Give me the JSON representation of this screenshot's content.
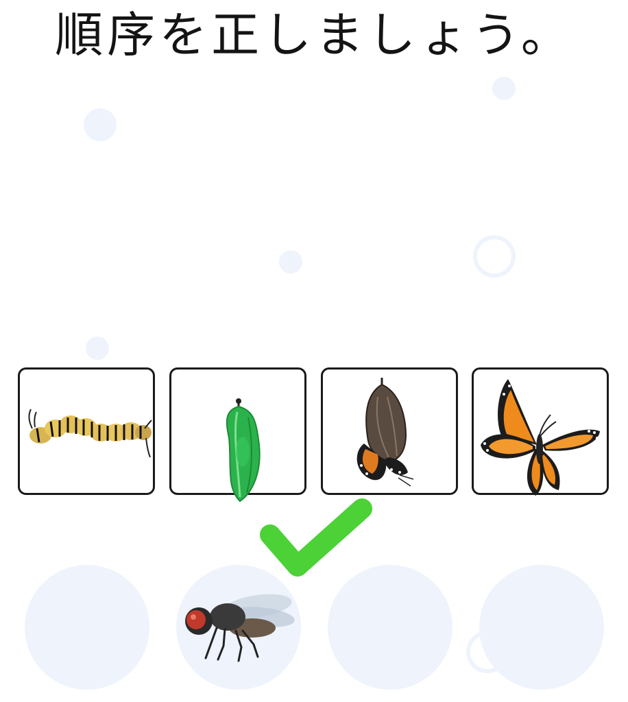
{
  "title": "順序を正しましょう。",
  "colors": {
    "bubble": "#eef3fc",
    "check": "#4cd137",
    "card_border": "#1a1a1a"
  },
  "cards": [
    {
      "icon": "caterpillar-icon"
    },
    {
      "icon": "chrysalis-icon"
    },
    {
      "icon": "emerging-butterfly-icon"
    },
    {
      "icon": "butterfly-icon"
    }
  ],
  "answer_slots": [
    {
      "icon": "empty"
    },
    {
      "icon": "fly-icon"
    },
    {
      "icon": "empty"
    },
    {
      "icon": "empty"
    }
  ],
  "feedback_icon": "checkmark-icon"
}
